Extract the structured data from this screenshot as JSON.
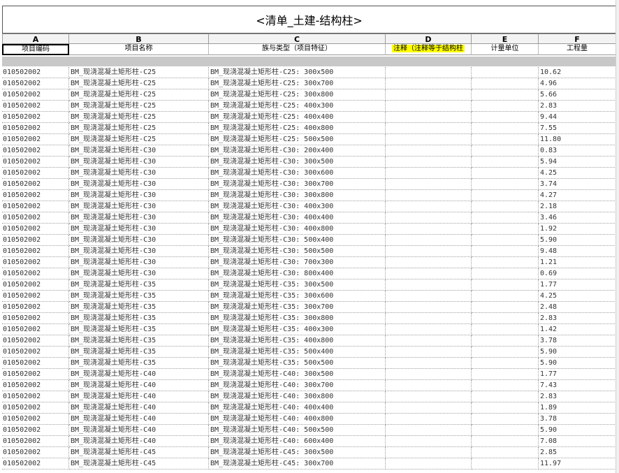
{
  "schedule": {
    "title": "<清单_土建-结构柱>",
    "column_letters": [
      "A",
      "B",
      "C",
      "D",
      "E",
      "F"
    ],
    "column_headers": [
      "项目编码",
      "项目名称",
      "族与类型（项目特征）",
      "注释（注释等于结构柱",
      "计量单位",
      "工程量"
    ],
    "highlight_color": "#ffff00",
    "rows": [
      [
        "010502002",
        "BM_现浇混凝土矩形柱-C25",
        "BM_现浇混凝土矩形柱-C25: 300x500",
        "",
        "",
        "10.62"
      ],
      [
        "010502002",
        "BM_现浇混凝土矩形柱-C25",
        "BM_现浇混凝土矩形柱-C25: 300x700",
        "",
        "",
        "4.96"
      ],
      [
        "010502002",
        "BM_现浇混凝土矩形柱-C25",
        "BM_现浇混凝土矩形柱-C25: 300x800",
        "",
        "",
        "5.66"
      ],
      [
        "010502002",
        "BM_现浇混凝土矩形柱-C25",
        "BM_现浇混凝土矩形柱-C25: 400x300",
        "",
        "",
        "2.83"
      ],
      [
        "010502002",
        "BM_现浇混凝土矩形柱-C25",
        "BM_现浇混凝土矩形柱-C25: 400x400",
        "",
        "",
        "9.44"
      ],
      [
        "010502002",
        "BM_现浇混凝土矩形柱-C25",
        "BM_现浇混凝土矩形柱-C25: 400x800",
        "",
        "",
        "7.55"
      ],
      [
        "010502002",
        "BM_现浇混凝土矩形柱-C25",
        "BM_现浇混凝土矩形柱-C25: 500x500",
        "",
        "",
        "11.80"
      ],
      [
        "010502002",
        "BM_现浇混凝土矩形柱-C30",
        "BM_现浇混凝土矩形柱-C30: 200x400",
        "",
        "",
        "0.83"
      ],
      [
        "010502002",
        "BM_现浇混凝土矩形柱-C30",
        "BM_现浇混凝土矩形柱-C30: 300x500",
        "",
        "",
        "5.94"
      ],
      [
        "010502002",
        "BM_现浇混凝土矩形柱-C30",
        "BM_现浇混凝土矩形柱-C30: 300x600",
        "",
        "",
        "4.25"
      ],
      [
        "010502002",
        "BM_现浇混凝土矩形柱-C30",
        "BM_现浇混凝土矩形柱-C30: 300x700",
        "",
        "",
        "3.74"
      ],
      [
        "010502002",
        "BM_现浇混凝土矩形柱-C30",
        "BM_现浇混凝土矩形柱-C30: 300x800",
        "",
        "",
        "4.27"
      ],
      [
        "010502002",
        "BM_现浇混凝土矩形柱-C30",
        "BM_现浇混凝土矩形柱-C30: 400x300",
        "",
        "",
        "2.18"
      ],
      [
        "010502002",
        "BM_现浇混凝土矩形柱-C30",
        "BM_现浇混凝土矩形柱-C30: 400x400",
        "",
        "",
        "3.46"
      ],
      [
        "010502002",
        "BM_现浇混凝土矩形柱-C30",
        "BM_现浇混凝土矩形柱-C30: 400x800",
        "",
        "",
        "1.92"
      ],
      [
        "010502002",
        "BM_现浇混凝土矩形柱-C30",
        "BM_现浇混凝土矩形柱-C30: 500x400",
        "",
        "",
        "5.90"
      ],
      [
        "010502002",
        "BM_现浇混凝土矩形柱-C30",
        "BM_现浇混凝土矩形柱-C30: 500x500",
        "",
        "",
        "9.48"
      ],
      [
        "010502002",
        "BM_现浇混凝土矩形柱-C30",
        "BM_现浇混凝土矩形柱-C30: 700x300",
        "",
        "",
        "1.21"
      ],
      [
        "010502002",
        "BM_现浇混凝土矩形柱-C30",
        "BM_现浇混凝土矩形柱-C30: 800x400",
        "",
        "",
        "0.69"
      ],
      [
        "010502002",
        "BM_现浇混凝土矩形柱-C35",
        "BM_现浇混凝土矩形柱-C35: 300x500",
        "",
        "",
        "1.77"
      ],
      [
        "010502002",
        "BM_现浇混凝土矩形柱-C35",
        "BM_现浇混凝土矩形柱-C35: 300x600",
        "",
        "",
        "4.25"
      ],
      [
        "010502002",
        "BM_现浇混凝土矩形柱-C35",
        "BM_现浇混凝土矩形柱-C35: 300x700",
        "",
        "",
        "2.48"
      ],
      [
        "010502002",
        "BM_现浇混凝土矩形柱-C35",
        "BM_现浇混凝土矩形柱-C35: 300x800",
        "",
        "",
        "2.83"
      ],
      [
        "010502002",
        "BM_现浇混凝土矩形柱-C35",
        "BM_现浇混凝土矩形柱-C35: 400x300",
        "",
        "",
        "1.42"
      ],
      [
        "010502002",
        "BM_现浇混凝土矩形柱-C35",
        "BM_现浇混凝土矩形柱-C35: 400x800",
        "",
        "",
        "3.78"
      ],
      [
        "010502002",
        "BM_现浇混凝土矩形柱-C35",
        "BM_现浇混凝土矩形柱-C35: 500x400",
        "",
        "",
        "5.90"
      ],
      [
        "010502002",
        "BM_现浇混凝土矩形柱-C35",
        "BM_现浇混凝土矩形柱-C35: 500x500",
        "",
        "",
        "5.90"
      ],
      [
        "010502002",
        "BM_现浇混凝土矩形柱-C40",
        "BM_现浇混凝土矩形柱-C40: 300x500",
        "",
        "",
        "1.77"
      ],
      [
        "010502002",
        "BM_现浇混凝土矩形柱-C40",
        "BM_现浇混凝土矩形柱-C40: 300x700",
        "",
        "",
        "7.43"
      ],
      [
        "010502002",
        "BM_现浇混凝土矩形柱-C40",
        "BM_现浇混凝土矩形柱-C40: 300x800",
        "",
        "",
        "2.83"
      ],
      [
        "010502002",
        "BM_现浇混凝土矩形柱-C40",
        "BM_现浇混凝土矩形柱-C40: 400x400",
        "",
        "",
        "1.89"
      ],
      [
        "010502002",
        "BM_现浇混凝土矩形柱-C40",
        "BM_现浇混凝土矩形柱-C40: 400x800",
        "",
        "",
        "3.78"
      ],
      [
        "010502002",
        "BM_现浇混凝土矩形柱-C40",
        "BM_现浇混凝土矩形柱-C40: 500x500",
        "",
        "",
        "5.90"
      ],
      [
        "010502002",
        "BM_现浇混凝土矩形柱-C40",
        "BM_现浇混凝土矩形柱-C40: 600x400",
        "",
        "",
        "7.08"
      ],
      [
        "010502002",
        "BM_现浇混凝土矩形柱-C45",
        "BM_现浇混凝土矩形柱-C45: 300x500",
        "",
        "",
        "2.85"
      ],
      [
        "010502002",
        "BM_现浇混凝土矩形柱-C45",
        "BM_现浇混凝土矩形柱-C45: 300x700",
        "",
        "",
        "11.97"
      ]
    ]
  }
}
